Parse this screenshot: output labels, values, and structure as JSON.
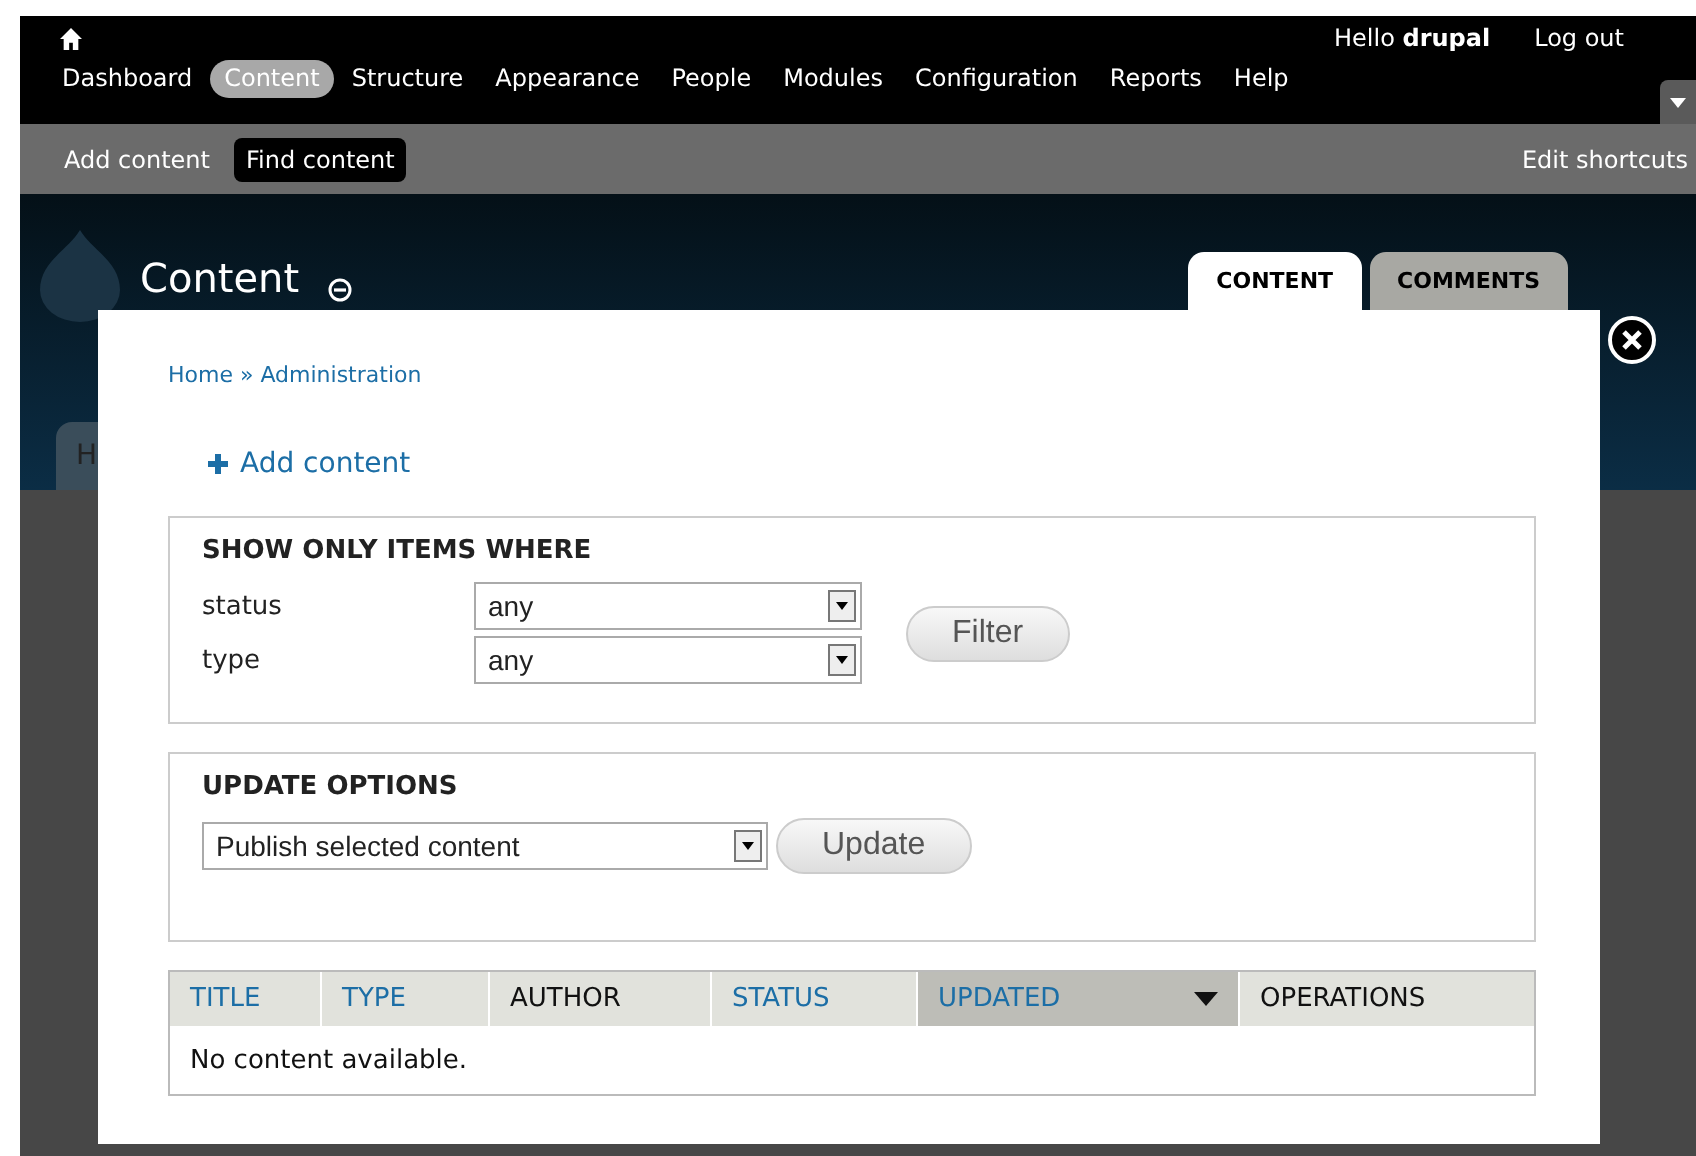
{
  "toolbar": {
    "greeting": "Hello **drupal**",
    "logout": "Log out",
    "menu": [
      {
        "label": "Dashboard",
        "selected": false
      },
      {
        "label": "Content",
        "selected": true
      },
      {
        "label": "Structure",
        "selected": false
      },
      {
        "label": "Appearance",
        "selected": false
      },
      {
        "label": "People",
        "selected": false
      },
      {
        "label": "Modules",
        "selected": false
      },
      {
        "label": "Configuration",
        "selected": false
      },
      {
        "label": "Reports",
        "selected": false
      },
      {
        "label": "Help",
        "selected": false
      }
    ],
    "shortcuts": [
      {
        "label": "Add content",
        "selected": false
      },
      {
        "label": "Find content",
        "selected": true
      }
    ],
    "edit_shortcuts": "Edit shortcuts"
  },
  "background": {
    "tab_fragment": "H"
  },
  "page": {
    "title": "Content",
    "tabs": [
      {
        "label": "CONTENT",
        "selected": true
      },
      {
        "label": "COMMENTS",
        "selected": false
      }
    ]
  },
  "overlay": {
    "breadcrumb": "Home » Administration",
    "add_link": "Add content",
    "filter": {
      "legend": "SHOW ONLY ITEMS WHERE",
      "fields": [
        {
          "label": "status",
          "value": "any"
        },
        {
          "label": "type",
          "value": "any"
        }
      ],
      "button": "Filter"
    },
    "update": {
      "legend": "UPDATE OPTIONS",
      "value": "Publish selected content",
      "button": "Update"
    },
    "table": {
      "columns": [
        {
          "label": "TITLE",
          "sortable": true,
          "selected": false
        },
        {
          "label": "TYPE",
          "sortable": true,
          "selected": false
        },
        {
          "label": "AUTHOR",
          "sortable": false,
          "selected": false
        },
        {
          "label": "STATUS",
          "sortable": true,
          "selected": false
        },
        {
          "label": "UPDATED",
          "sortable": true,
          "selected": true
        },
        {
          "label": "OPERATIONS",
          "sortable": false,
          "selected": false
        }
      ],
      "empty": "No content available."
    }
  }
}
